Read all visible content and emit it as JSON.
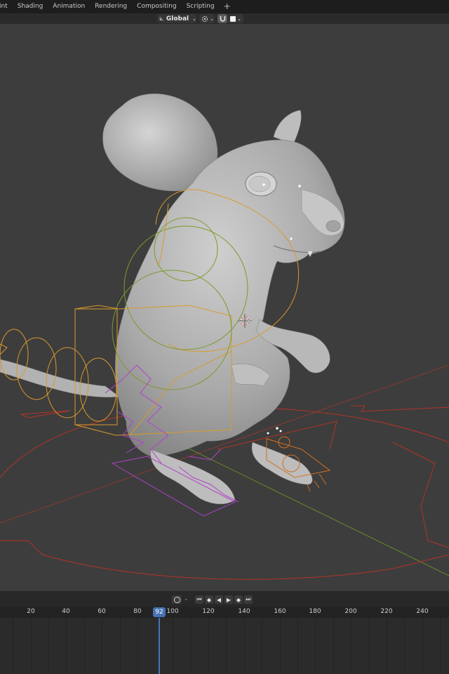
{
  "workspace_tabs": [
    {
      "label": "int"
    },
    {
      "label": "Shading"
    },
    {
      "label": "Animation"
    },
    {
      "label": "Rendering"
    },
    {
      "label": "Compositing"
    },
    {
      "label": "Scripting"
    }
  ],
  "add_workspace_label": "+",
  "viewport_header": {
    "transform_orientation": "Global",
    "pivot_icon": "pivot-point-icon",
    "snap_icon": "snap-magnet-icon",
    "proportional_icon": "proportional-edit-icon"
  },
  "playback": {
    "buttons": [
      {
        "icon": "jump-to-start-icon",
        "glyph": "⏮"
      },
      {
        "icon": "jump-to-keyframe-back-icon",
        "glyph": "◆"
      },
      {
        "icon": "play-reverse-icon",
        "glyph": "◀"
      },
      {
        "icon": "play-icon",
        "glyph": "▶"
      },
      {
        "icon": "jump-to-keyframe-forward-icon",
        "glyph": "◆"
      },
      {
        "icon": "jump-to-end-icon",
        "glyph": "⏭"
      }
    ]
  },
  "timeline": {
    "ticks": [
      "20",
      "40",
      "60",
      "80",
      "100",
      "120",
      "140",
      "160",
      "180",
      "200",
      "220",
      "240"
    ],
    "current_frame": "92"
  },
  "colors": {
    "accent": "#4772b3",
    "bone_orange": "#e0a030",
    "bone_green": "#7a9a3a",
    "bone_purple": "#b03ec8",
    "bone_red": "#c0392b"
  }
}
